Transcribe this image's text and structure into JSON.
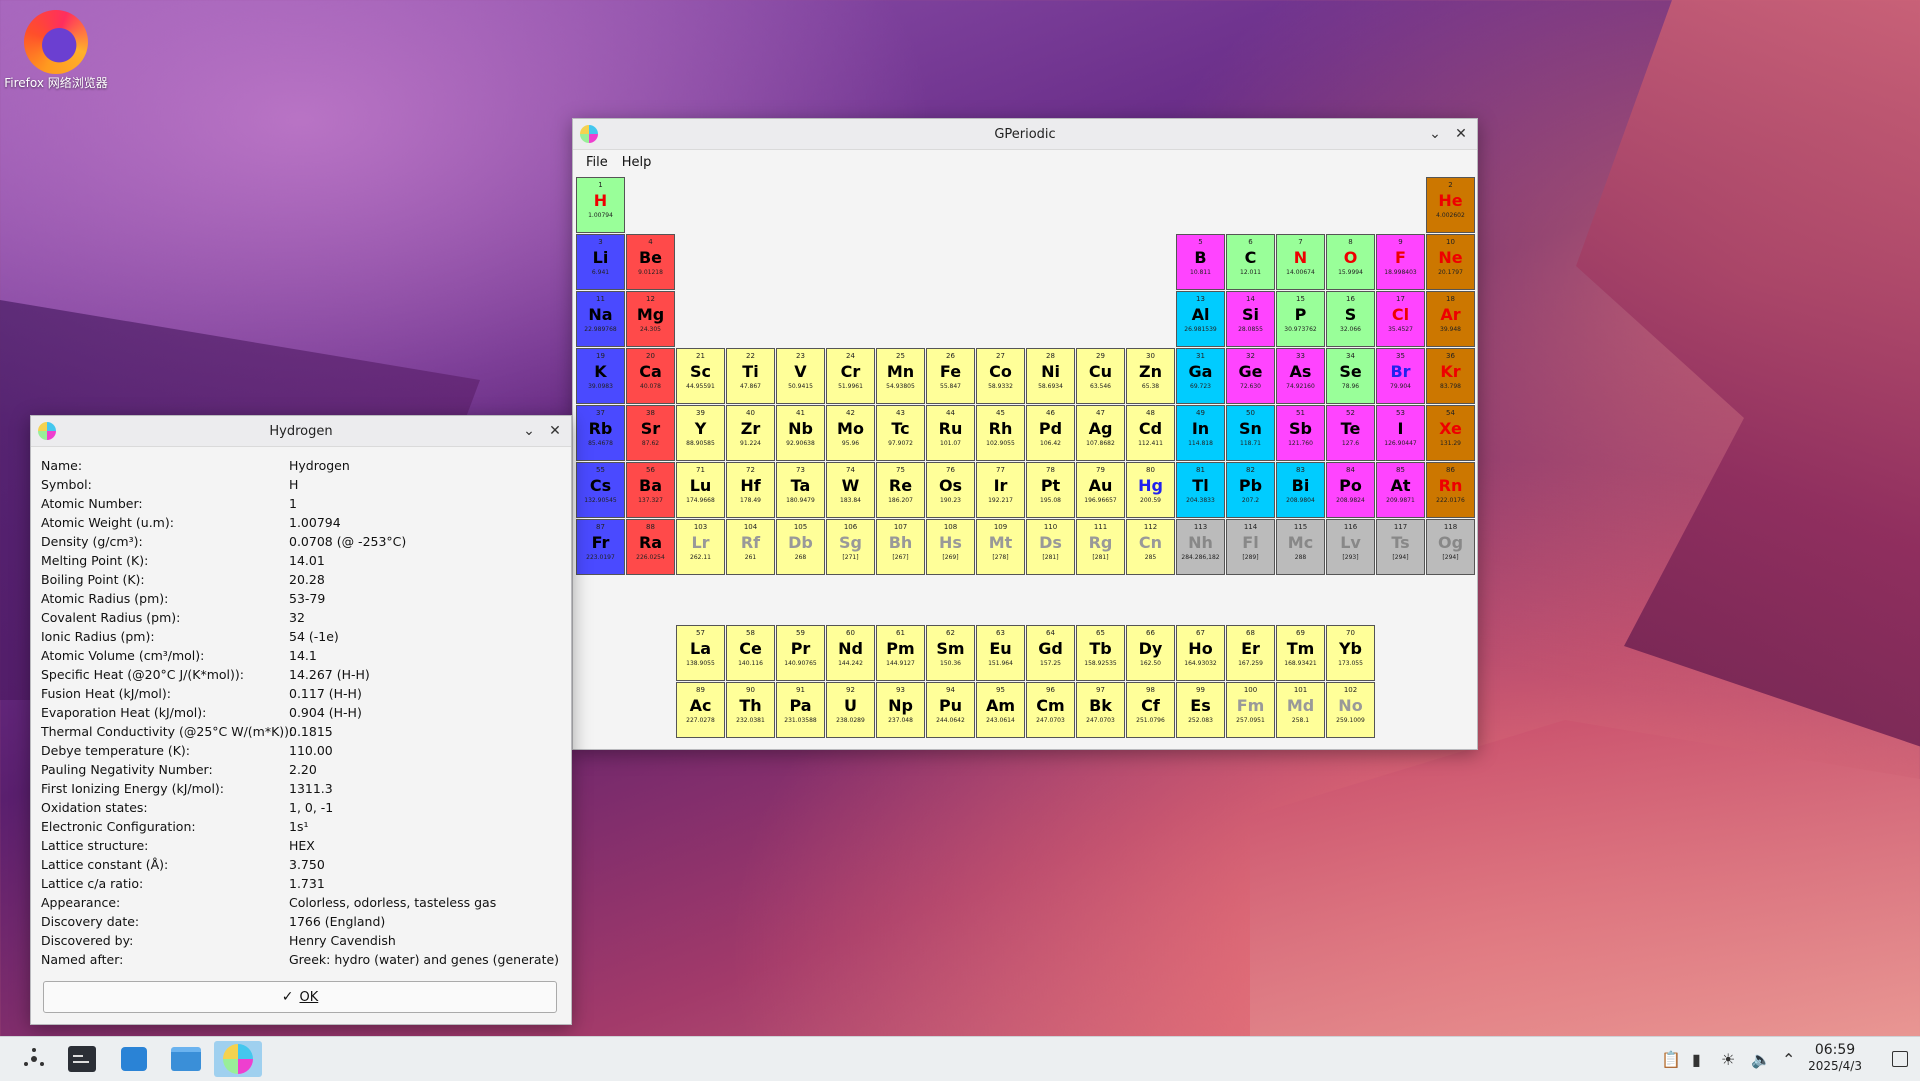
{
  "desktop": {
    "firefox_label": "Firefox 网络浏览器"
  },
  "main_window": {
    "title": "GPeriodic",
    "menu": [
      "File",
      "Help"
    ]
  },
  "colors": {
    "alkali": "#4a4aff",
    "alkaline": "#ff4a4a",
    "transition": "#ffff99",
    "post_transition": "#00ccff",
    "metalloid": "#ff44ff",
    "nonmetal": "#99ff99",
    "noble": "#cc7700",
    "unknown": "#bbbbbb"
  },
  "elements": [
    {
      "n": "1",
      "s": "H",
      "w": "1.00794",
      "r": 1,
      "c": 1,
      "t": "nonmetal",
      "sc": "#ee0000"
    },
    {
      "n": "2",
      "s": "He",
      "w": "4.002602",
      "r": 1,
      "c": 18,
      "t": "noble",
      "sc": "#ee0000"
    },
    {
      "n": "3",
      "s": "Li",
      "w": "6.941",
      "r": 2,
      "c": 1,
      "t": "alkali"
    },
    {
      "n": "4",
      "s": "Be",
      "w": "9.01218",
      "r": 2,
      "c": 2,
      "t": "alkaline"
    },
    {
      "n": "5",
      "s": "B",
      "w": "10.811",
      "r": 2,
      "c": 13,
      "t": "metalloid"
    },
    {
      "n": "6",
      "s": "C",
      "w": "12.011",
      "r": 2,
      "c": 14,
      "t": "nonmetal"
    },
    {
      "n": "7",
      "s": "N",
      "w": "14.00674",
      "r": 2,
      "c": 15,
      "t": "nonmetal",
      "sc": "#ee0000"
    },
    {
      "n": "8",
      "s": "O",
      "w": "15.9994",
      "r": 2,
      "c": 16,
      "t": "nonmetal",
      "sc": "#ee0000"
    },
    {
      "n": "9",
      "s": "F",
      "w": "18.998403",
      "r": 2,
      "c": 17,
      "t": "metalloid",
      "sc": "#ee0000"
    },
    {
      "n": "10",
      "s": "Ne",
      "w": "20.1797",
      "r": 2,
      "c": 18,
      "t": "noble",
      "sc": "#ee0000"
    },
    {
      "n": "11",
      "s": "Na",
      "w": "22.989768",
      "r": 3,
      "c": 1,
      "t": "alkali"
    },
    {
      "n": "12",
      "s": "Mg",
      "w": "24.305",
      "r": 3,
      "c": 2,
      "t": "alkaline"
    },
    {
      "n": "13",
      "s": "Al",
      "w": "26.981539",
      "r": 3,
      "c": 13,
      "t": "post_transition"
    },
    {
      "n": "14",
      "s": "Si",
      "w": "28.0855",
      "r": 3,
      "c": 14,
      "t": "metalloid"
    },
    {
      "n": "15",
      "s": "P",
      "w": "30.973762",
      "r": 3,
      "c": 15,
      "t": "nonmetal"
    },
    {
      "n": "16",
      "s": "S",
      "w": "32.066",
      "r": 3,
      "c": 16,
      "t": "nonmetal"
    },
    {
      "n": "17",
      "s": "Cl",
      "w": "35.4527",
      "r": 3,
      "c": 17,
      "t": "metalloid",
      "sc": "#ee0000"
    },
    {
      "n": "18",
      "s": "Ar",
      "w": "39.948",
      "r": 3,
      "c": 18,
      "t": "noble",
      "sc": "#ee0000"
    },
    {
      "n": "19",
      "s": "K",
      "w": "39.0983",
      "r": 4,
      "c": 1,
      "t": "alkali"
    },
    {
      "n": "20",
      "s": "Ca",
      "w": "40.078",
      "r": 4,
      "c": 2,
      "t": "alkaline"
    },
    {
      "n": "21",
      "s": "Sc",
      "w": "44.95591",
      "r": 4,
      "c": 3,
      "t": "transition"
    },
    {
      "n": "22",
      "s": "Ti",
      "w": "47.867",
      "r": 4,
      "c": 4,
      "t": "transition"
    },
    {
      "n": "23",
      "s": "V",
      "w": "50.9415",
      "r": 4,
      "c": 5,
      "t": "transition"
    },
    {
      "n": "24",
      "s": "Cr",
      "w": "51.9961",
      "r": 4,
      "c": 6,
      "t": "transition"
    },
    {
      "n": "25",
      "s": "Mn",
      "w": "54.93805",
      "r": 4,
      "c": 7,
      "t": "transition"
    },
    {
      "n": "26",
      "s": "Fe",
      "w": "55.847",
      "r": 4,
      "c": 8,
      "t": "transition"
    },
    {
      "n": "27",
      "s": "Co",
      "w": "58.9332",
      "r": 4,
      "c": 9,
      "t": "transition"
    },
    {
      "n": "28",
      "s": "Ni",
      "w": "58.6934",
      "r": 4,
      "c": 10,
      "t": "transition"
    },
    {
      "n": "29",
      "s": "Cu",
      "w": "63.546",
      "r": 4,
      "c": 11,
      "t": "transition"
    },
    {
      "n": "30",
      "s": "Zn",
      "w": "65.38",
      "r": 4,
      "c": 12,
      "t": "transition"
    },
    {
      "n": "31",
      "s": "Ga",
      "w": "69.723",
      "r": 4,
      "c": 13,
      "t": "post_transition"
    },
    {
      "n": "32",
      "s": "Ge",
      "w": "72.630",
      "r": 4,
      "c": 14,
      "t": "metalloid"
    },
    {
      "n": "33",
      "s": "As",
      "w": "74.92160",
      "r": 4,
      "c": 15,
      "t": "metalloid"
    },
    {
      "n": "34",
      "s": "Se",
      "w": "78.96",
      "r": 4,
      "c": 16,
      "t": "nonmetal"
    },
    {
      "n": "35",
      "s": "Br",
      "w": "79.904",
      "r": 4,
      "c": 17,
      "t": "metalloid",
      "sc": "#2222ee"
    },
    {
      "n": "36",
      "s": "Kr",
      "w": "83.798",
      "r": 4,
      "c": 18,
      "t": "noble",
      "sc": "#ee0000"
    },
    {
      "n": "37",
      "s": "Rb",
      "w": "85.4678",
      "r": 5,
      "c": 1,
      "t": "alkali"
    },
    {
      "n": "38",
      "s": "Sr",
      "w": "87.62",
      "r": 5,
      "c": 2,
      "t": "alkaline"
    },
    {
      "n": "39",
      "s": "Y",
      "w": "88.90585",
      "r": 5,
      "c": 3,
      "t": "transition"
    },
    {
      "n": "40",
      "s": "Zr",
      "w": "91.224",
      "r": 5,
      "c": 4,
      "t": "transition"
    },
    {
      "n": "41",
      "s": "Nb",
      "w": "92.90638",
      "r": 5,
      "c": 5,
      "t": "transition"
    },
    {
      "n": "42",
      "s": "Mo",
      "w": "95.96",
      "r": 5,
      "c": 6,
      "t": "transition"
    },
    {
      "n": "43",
      "s": "Tc",
      "w": "97.9072",
      "r": 5,
      "c": 7,
      "t": "transition"
    },
    {
      "n": "44",
      "s": "Ru",
      "w": "101.07",
      "r": 5,
      "c": 8,
      "t": "transition"
    },
    {
      "n": "45",
      "s": "Rh",
      "w": "102.9055",
      "r": 5,
      "c": 9,
      "t": "transition"
    },
    {
      "n": "46",
      "s": "Pd",
      "w": "106.42",
      "r": 5,
      "c": 10,
      "t": "transition"
    },
    {
      "n": "47",
      "s": "Ag",
      "w": "107.8682",
      "r": 5,
      "c": 11,
      "t": "transition"
    },
    {
      "n": "48",
      "s": "Cd",
      "w": "112.411",
      "r": 5,
      "c": 12,
      "t": "transition"
    },
    {
      "n": "49",
      "s": "In",
      "w": "114.818",
      "r": 5,
      "c": 13,
      "t": "post_transition"
    },
    {
      "n": "50",
      "s": "Sn",
      "w": "118.71",
      "r": 5,
      "c": 14,
      "t": "post_transition"
    },
    {
      "n": "51",
      "s": "Sb",
      "w": "121.760",
      "r": 5,
      "c": 15,
      "t": "metalloid"
    },
    {
      "n": "52",
      "s": "Te",
      "w": "127.6",
      "r": 5,
      "c": 16,
      "t": "metalloid"
    },
    {
      "n": "53",
      "s": "I",
      "w": "126.90447",
      "r": 5,
      "c": 17,
      "t": "metalloid"
    },
    {
      "n": "54",
      "s": "Xe",
      "w": "131.29",
      "r": 5,
      "c": 18,
      "t": "noble",
      "sc": "#ee0000"
    },
    {
      "n": "55",
      "s": "Cs",
      "w": "132.90545",
      "r": 6,
      "c": 1,
      "t": "alkali"
    },
    {
      "n": "56",
      "s": "Ba",
      "w": "137.327",
      "r": 6,
      "c": 2,
      "t": "alkaline"
    },
    {
      "n": "71",
      "s": "Lu",
      "w": "174.9668",
      "r": 6,
      "c": 3,
      "t": "transition"
    },
    {
      "n": "72",
      "s": "Hf",
      "w": "178.49",
      "r": 6,
      "c": 4,
      "t": "transition"
    },
    {
      "n": "73",
      "s": "Ta",
      "w": "180.9479",
      "r": 6,
      "c": 5,
      "t": "transition"
    },
    {
      "n": "74",
      "s": "W",
      "w": "183.84",
      "r": 6,
      "c": 6,
      "t": "transition"
    },
    {
      "n": "75",
      "s": "Re",
      "w": "186.207",
      "r": 6,
      "c": 7,
      "t": "transition"
    },
    {
      "n": "76",
      "s": "Os",
      "w": "190.23",
      "r": 6,
      "c": 8,
      "t": "transition"
    },
    {
      "n": "77",
      "s": "Ir",
      "w": "192.217",
      "r": 6,
      "c": 9,
      "t": "transition"
    },
    {
      "n": "78",
      "s": "Pt",
      "w": "195.08",
      "r": 6,
      "c": 10,
      "t": "transition"
    },
    {
      "n": "79",
      "s": "Au",
      "w": "196.96657",
      "r": 6,
      "c": 11,
      "t": "transition"
    },
    {
      "n": "80",
      "s": "Hg",
      "w": "200.59",
      "r": 6,
      "c": 12,
      "t": "transition",
      "sc": "#2222ee"
    },
    {
      "n": "81",
      "s": "Tl",
      "w": "204.3833",
      "r": 6,
      "c": 13,
      "t": "post_transition"
    },
    {
      "n": "82",
      "s": "Pb",
      "w": "207.2",
      "r": 6,
      "c": 14,
      "t": "post_transition"
    },
    {
      "n": "83",
      "s": "Bi",
      "w": "208.9804",
      "r": 6,
      "c": 15,
      "t": "post_transition"
    },
    {
      "n": "84",
      "s": "Po",
      "w": "208.9824",
      "r": 6,
      "c": 16,
      "t": "metalloid"
    },
    {
      "n": "85",
      "s": "At",
      "w": "209.9871",
      "r": 6,
      "c": 17,
      "t": "metalloid"
    },
    {
      "n": "86",
      "s": "Rn",
      "w": "222.0176",
      "r": 6,
      "c": 18,
      "t": "noble",
      "sc": "#ee0000"
    },
    {
      "n": "87",
      "s": "Fr",
      "w": "223.0197",
      "r": 7,
      "c": 1,
      "t": "alkali"
    },
    {
      "n": "88",
      "s": "Ra",
      "w": "226.0254",
      "r": 7,
      "c": 2,
      "t": "alkaline"
    },
    {
      "n": "103",
      "s": "Lr",
      "w": "262.11",
      "r": 7,
      "c": 3,
      "t": "transition",
      "sc": "#999999"
    },
    {
      "n": "104",
      "s": "Rf",
      "w": "261",
      "r": 7,
      "c": 4,
      "t": "transition",
      "sc": "#999999"
    },
    {
      "n": "105",
      "s": "Db",
      "w": "268",
      "r": 7,
      "c": 5,
      "t": "transition",
      "sc": "#999999"
    },
    {
      "n": "106",
      "s": "Sg",
      "w": "[271]",
      "r": 7,
      "c": 6,
      "t": "transition",
      "sc": "#999999"
    },
    {
      "n": "107",
      "s": "Bh",
      "w": "[267]",
      "r": 7,
      "c": 7,
      "t": "transition",
      "sc": "#999999"
    },
    {
      "n": "108",
      "s": "Hs",
      "w": "[269]",
      "r": 7,
      "c": 8,
      "t": "transition",
      "sc": "#999999"
    },
    {
      "n": "109",
      "s": "Mt",
      "w": "[278]",
      "r": 7,
      "c": 9,
      "t": "transition",
      "sc": "#999999"
    },
    {
      "n": "110",
      "s": "Ds",
      "w": "[281]",
      "r": 7,
      "c": 10,
      "t": "transition",
      "sc": "#999999"
    },
    {
      "n": "111",
      "s": "Rg",
      "w": "[281]",
      "r": 7,
      "c": 11,
      "t": "transition",
      "sc": "#999999"
    },
    {
      "n": "112",
      "s": "Cn",
      "w": "285",
      "r": 7,
      "c": 12,
      "t": "transition",
      "sc": "#999999"
    },
    {
      "n": "113",
      "s": "Nh",
      "w": "284.286,182",
      "r": 7,
      "c": 13,
      "t": "unknown",
      "sc": "#888888"
    },
    {
      "n": "114",
      "s": "Fl",
      "w": "[289]",
      "r": 7,
      "c": 14,
      "t": "unknown",
      "sc": "#888888"
    },
    {
      "n": "115",
      "s": "Mc",
      "w": "288",
      "r": 7,
      "c": 15,
      "t": "unknown",
      "sc": "#888888"
    },
    {
      "n": "116",
      "s": "Lv",
      "w": "[293]",
      "r": 7,
      "c": 16,
      "t": "unknown",
      "sc": "#888888"
    },
    {
      "n": "117",
      "s": "Ts",
      "w": "[294]",
      "r": 7,
      "c": 17,
      "t": "unknown",
      "sc": "#888888"
    },
    {
      "n": "118",
      "s": "Og",
      "w": "[294]",
      "r": 7,
      "c": 18,
      "t": "unknown",
      "sc": "#888888"
    },
    {
      "n": "57",
      "s": "La",
      "w": "138.9055",
      "r": 9,
      "c": 3,
      "t": "transition"
    },
    {
      "n": "58",
      "s": "Ce",
      "w": "140.116",
      "r": 9,
      "c": 4,
      "t": "transition"
    },
    {
      "n": "59",
      "s": "Pr",
      "w": "140.90765",
      "r": 9,
      "c": 5,
      "t": "transition"
    },
    {
      "n": "60",
      "s": "Nd",
      "w": "144.242",
      "r": 9,
      "c": 6,
      "t": "transition"
    },
    {
      "n": "61",
      "s": "Pm",
      "w": "144.9127",
      "r": 9,
      "c": 7,
      "t": "transition"
    },
    {
      "n": "62",
      "s": "Sm",
      "w": "150.36",
      "r": 9,
      "c": 8,
      "t": "transition"
    },
    {
      "n": "63",
      "s": "Eu",
      "w": "151.964",
      "r": 9,
      "c": 9,
      "t": "transition"
    },
    {
      "n": "64",
      "s": "Gd",
      "w": "157.25",
      "r": 9,
      "c": 10,
      "t": "transition"
    },
    {
      "n": "65",
      "s": "Tb",
      "w": "158.92535",
      "r": 9,
      "c": 11,
      "t": "transition"
    },
    {
      "n": "66",
      "s": "Dy",
      "w": "162.50",
      "r": 9,
      "c": 12,
      "t": "transition"
    },
    {
      "n": "67",
      "s": "Ho",
      "w": "164.93032",
      "r": 9,
      "c": 13,
      "t": "transition"
    },
    {
      "n": "68",
      "s": "Er",
      "w": "167.259",
      "r": 9,
      "c": 14,
      "t": "transition"
    },
    {
      "n": "69",
      "s": "Tm",
      "w": "168.93421",
      "r": 9,
      "c": 15,
      "t": "transition"
    },
    {
      "n": "70",
      "s": "Yb",
      "w": "173.055",
      "r": 9,
      "c": 16,
      "t": "transition"
    },
    {
      "n": "89",
      "s": "Ac",
      "w": "227.0278",
      "r": 10,
      "c": 3,
      "t": "transition"
    },
    {
      "n": "90",
      "s": "Th",
      "w": "232.0381",
      "r": 10,
      "c": 4,
      "t": "transition"
    },
    {
      "n": "91",
      "s": "Pa",
      "w": "231.03588",
      "r": 10,
      "c": 5,
      "t": "transition"
    },
    {
      "n": "92",
      "s": "U",
      "w": "238.0289",
      "r": 10,
      "c": 6,
      "t": "transition"
    },
    {
      "n": "93",
      "s": "Np",
      "w": "237.048",
      "r": 10,
      "c": 7,
      "t": "transition"
    },
    {
      "n": "94",
      "s": "Pu",
      "w": "244.0642",
      "r": 10,
      "c": 8,
      "t": "transition"
    },
    {
      "n": "95",
      "s": "Am",
      "w": "243.0614",
      "r": 10,
      "c": 9,
      "t": "transition"
    },
    {
      "n": "96",
      "s": "Cm",
      "w": "247.0703",
      "r": 10,
      "c": 10,
      "t": "transition"
    },
    {
      "n": "97",
      "s": "Bk",
      "w": "247.0703",
      "r": 10,
      "c": 11,
      "t": "transition"
    },
    {
      "n": "98",
      "s": "Cf",
      "w": "251.0796",
      "r": 10,
      "c": 12,
      "t": "transition"
    },
    {
      "n": "99",
      "s": "Es",
      "w": "252.083",
      "r": 10,
      "c": 13,
      "t": "transition"
    },
    {
      "n": "100",
      "s": "Fm",
      "w": "257.0951",
      "r": 10,
      "c": 14,
      "t": "transition",
      "sc": "#999999"
    },
    {
      "n": "101",
      "s": "Md",
      "w": "258.1",
      "r": 10,
      "c": 15,
      "t": "transition",
      "sc": "#999999"
    },
    {
      "n": "102",
      "s": "No",
      "w": "259.1009",
      "r": 10,
      "c": 16,
      "t": "transition",
      "sc": "#999999"
    }
  ],
  "detail_dialog": {
    "title": "Hydrogen",
    "rows": [
      {
        "label": "Name:",
        "value": "Hydrogen"
      },
      {
        "label": "Symbol:",
        "value": "H"
      },
      {
        "label": "Atomic Number:",
        "value": "1"
      },
      {
        "label": "Atomic Weight (u.m):",
        "value": "1.00794"
      },
      {
        "label": "Density (g/cm³):",
        "value": "0.0708 (@ -253°C)"
      },
      {
        "label": "Melting Point (K):",
        "value": "14.01"
      },
      {
        "label": "Boiling Point (K):",
        "value": "20.28"
      },
      {
        "label": "Atomic Radius (pm):",
        "value": "53-79"
      },
      {
        "label": "Covalent Radius (pm):",
        "value": "32"
      },
      {
        "label": "Ionic Radius (pm):",
        "value": "54 (-1e)"
      },
      {
        "label": "Atomic Volume (cm³/mol):",
        "value": "14.1"
      },
      {
        "label": "Specific Heat (@20°C J/(K*mol)):",
        "value": "14.267 (H-H)"
      },
      {
        "label": "Fusion Heat (kJ/mol):",
        "value": "0.117 (H-H)"
      },
      {
        "label": "Evaporation Heat (kJ/mol):",
        "value": "0.904 (H-H)"
      },
      {
        "label": "Thermal Conductivity (@25°C W/(m*K)):",
        "value": "0.1815"
      },
      {
        "label": "Debye temperature (K):",
        "value": "110.00"
      },
      {
        "label": "Pauling Negativity Number:",
        "value": "2.20"
      },
      {
        "label": "First Ionizing Energy (kJ/mol):",
        "value": "1311.3"
      },
      {
        "label": "Oxidation states:",
        "value": "1, 0, -1"
      },
      {
        "label": "Electronic Configuration:",
        "value": "1s¹"
      },
      {
        "label": "Lattice structure:",
        "value": "HEX"
      },
      {
        "label": "Lattice constant (Å):",
        "value": "3.750"
      },
      {
        "label": "Lattice c/a ratio:",
        "value": "1.731"
      },
      {
        "label": "Appearance:",
        "value": "Colorless, odorless, tasteless gas"
      },
      {
        "label": "Discovery date:",
        "value": "1766 (England)"
      },
      {
        "label": "Discovered by:",
        "value": "Henry Cavendish"
      },
      {
        "label": "Named after:",
        "value": "Greek: hydro (water) and genes (generate)"
      }
    ],
    "ok_label": "OK"
  },
  "taskbar": {
    "time": "06:59",
    "date": "2025/4/3"
  }
}
